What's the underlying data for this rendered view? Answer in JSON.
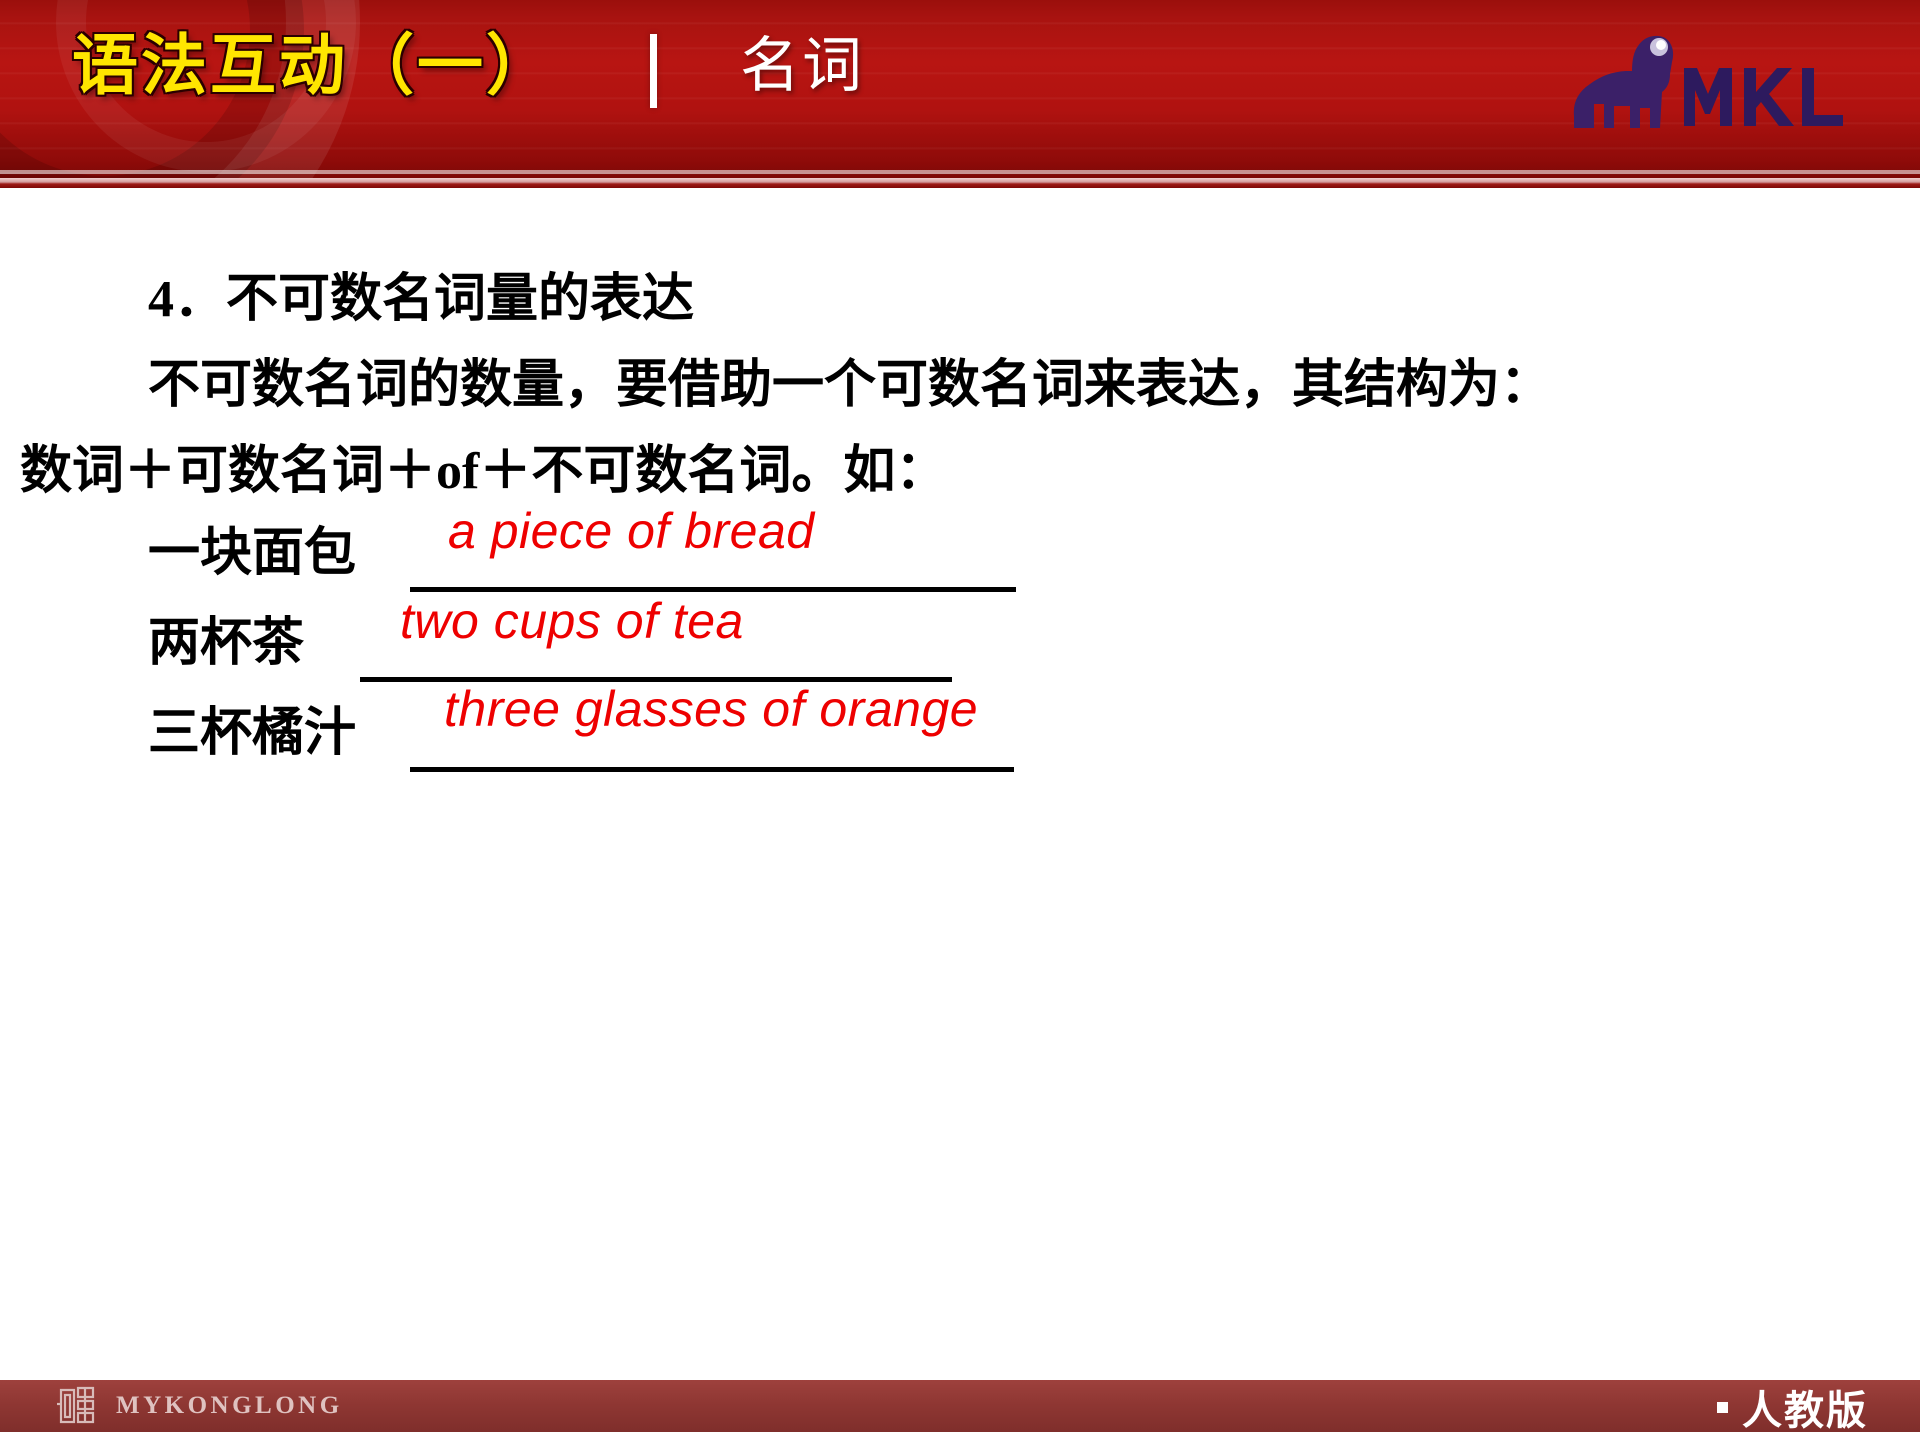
{
  "header": {
    "title": "语法互动（一）",
    "separator": "|",
    "subtitle": "名词",
    "logo_text": "MKL",
    "logo_icon": "dinosaur-icon",
    "colors": {
      "banner_red": "#b01210",
      "title_yellow": "#ffe600",
      "subtitle_white": "#ffffff",
      "logo_purple": "#3b2068"
    }
  },
  "body": {
    "heading": "4．不可数名词量的表达",
    "paragraph_line_1": "不可数名词的数量，要借助一个可数名词来表达，其结构为：",
    "paragraph_line_2": "数词＋可数名词＋of＋不可数名词。如：",
    "answers": [
      {
        "prompt": "一块面包",
        "answer": "a piece of bread"
      },
      {
        "prompt": "两杯茶",
        "answer": "two cups of tea"
      },
      {
        "prompt": "三杯橘汁",
        "answer": "three glasses of orange"
      }
    ],
    "answer_color": "#ee0000"
  },
  "footer": {
    "brand": "MYKONGLONG",
    "mark_icon": "konglong-seal-icon",
    "bullet": "square-bullet-icon",
    "edition": "人教版",
    "bar_color": "#8f3733"
  }
}
